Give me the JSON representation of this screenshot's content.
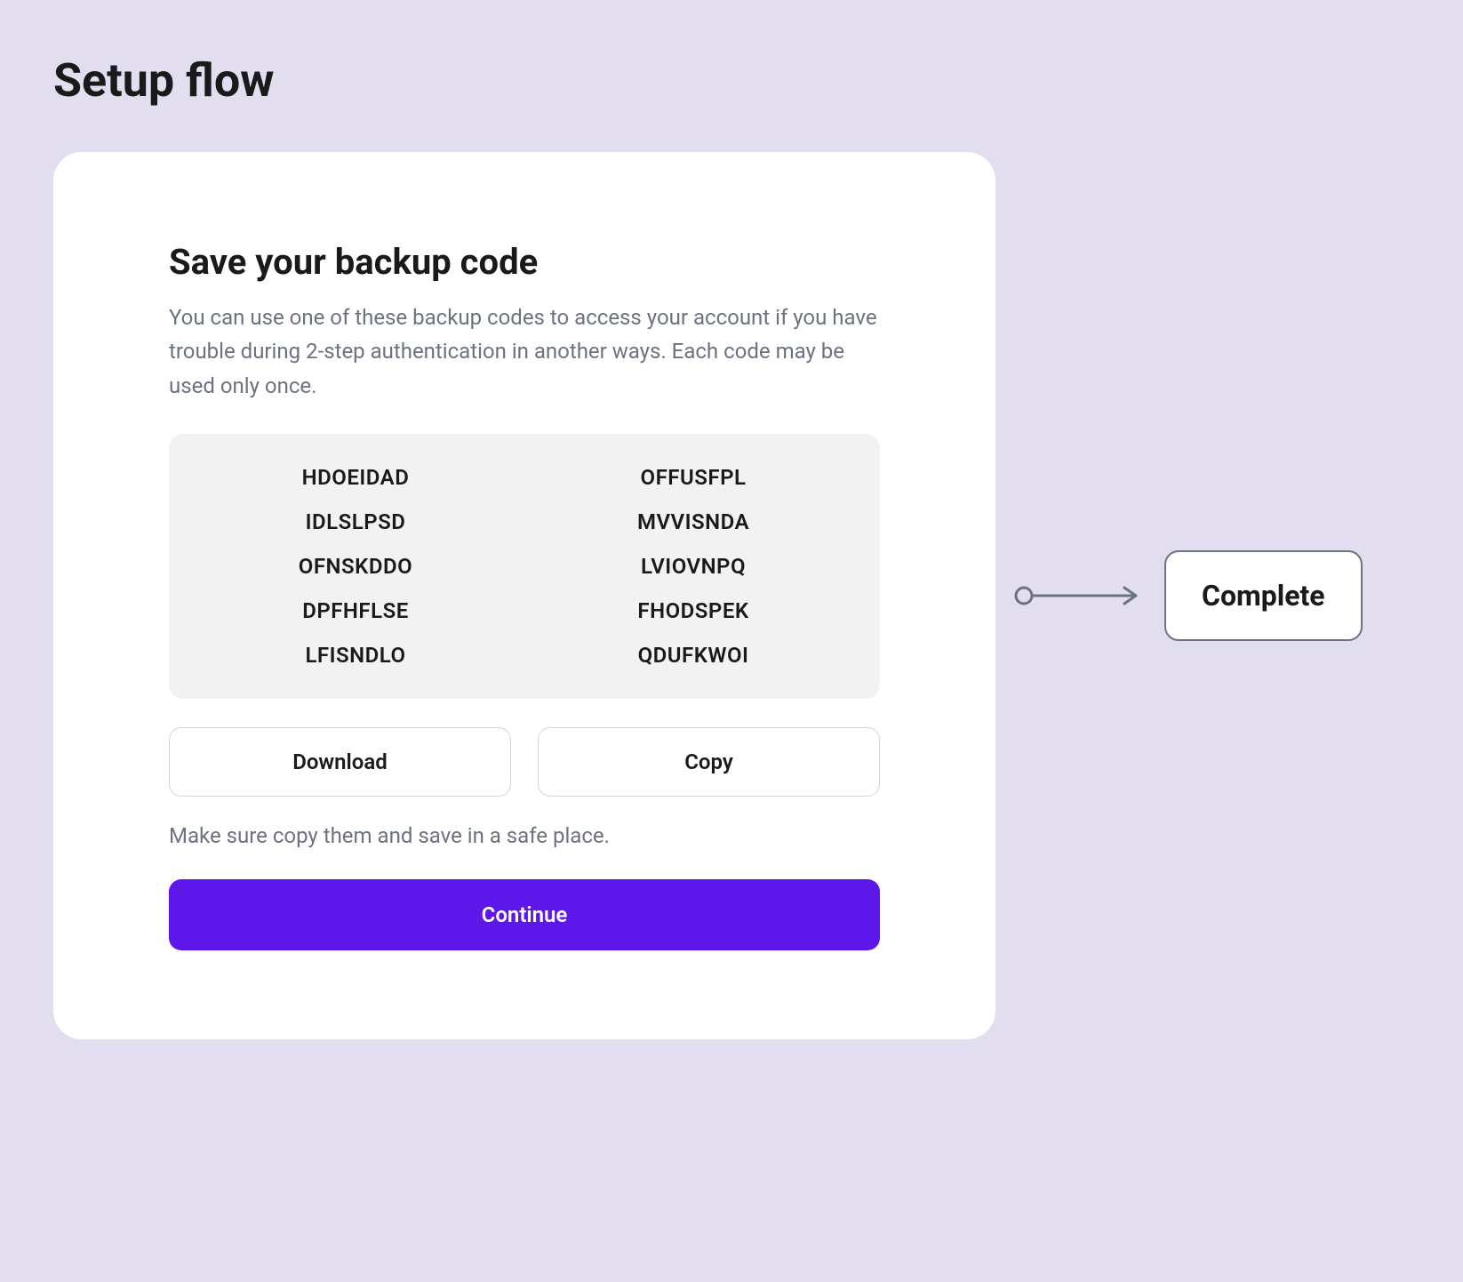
{
  "page": {
    "title": "Setup flow"
  },
  "card": {
    "title": "Save your backup code",
    "description": "You can use one of these backup codes to access your account if you have trouble during 2-step authentication in another ways. Each code may be used only once.",
    "codes": {
      "left": [
        "HDOEIDAD",
        "IDLSLPSD",
        "OFNSKDDO",
        "DPFHFLSE",
        "LFISNDLO"
      ],
      "right": [
        "OFFUSFPL",
        "MVVISNDA",
        "LVIOVNPQ",
        "FHODSPEK",
        "QDUFKWOI"
      ]
    },
    "buttons": {
      "download": "Download",
      "copy": "Copy",
      "continue": "Continue"
    },
    "helper_text": "Make sure copy them and save in a safe place."
  },
  "flow": {
    "next_label": "Complete"
  },
  "colors": {
    "background": "#E3DEEF",
    "primary": "#5E17EB",
    "text_muted": "#6b7280",
    "codes_bg": "#F2F2F2"
  }
}
